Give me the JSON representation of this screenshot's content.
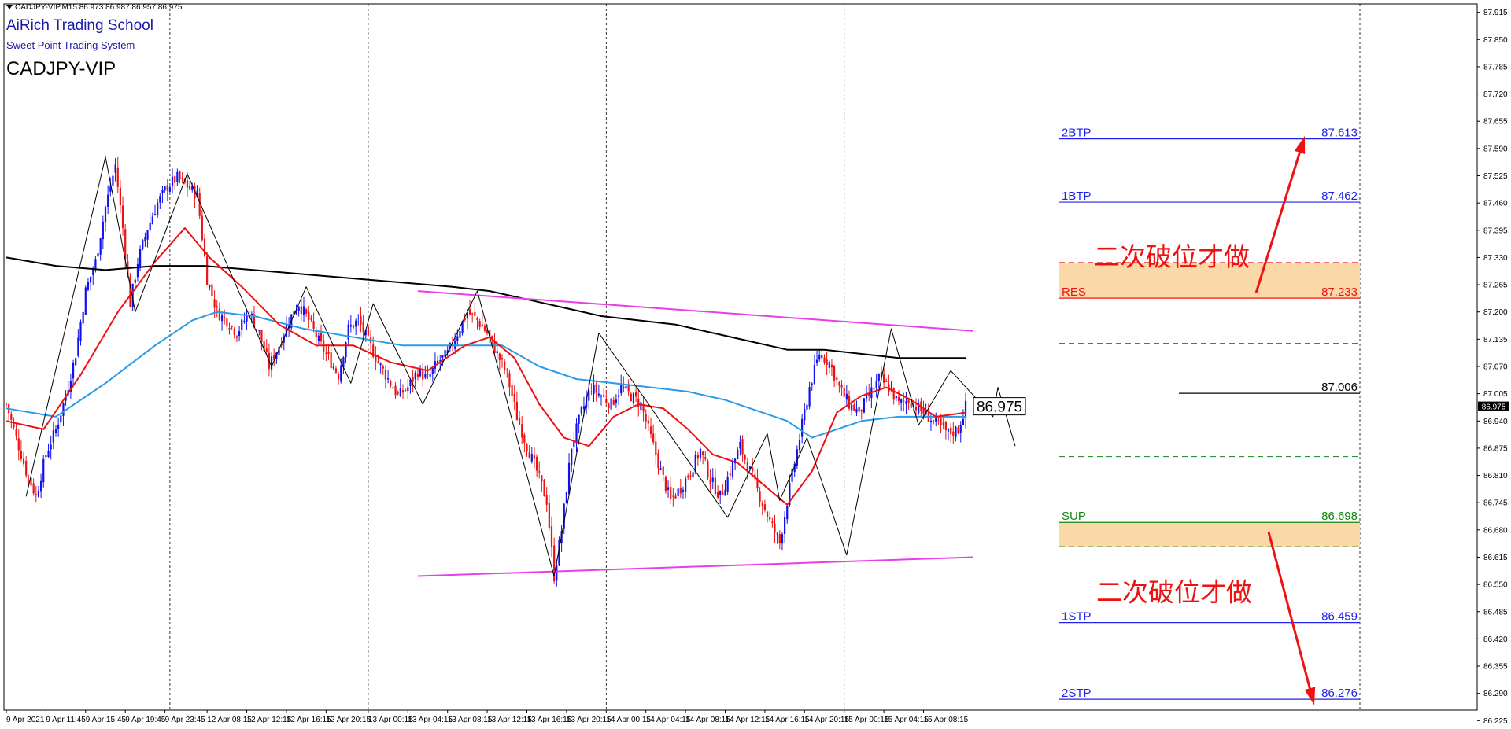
{
  "header": {
    "symbol_bar": "CADJPY-VIP,M15  86.973 86.987 86.957 86.975",
    "school": "AiRich Trading School",
    "system": "Sweet Point Trading System",
    "symbol": "CADJPY-VIP"
  },
  "colors": {
    "bull_candle": "#1111ee",
    "bear_candle": "#ee1111",
    "ma_red": "#ee1111",
    "ma_blue": "#2a9be8",
    "ma_black": "#000000",
    "channel": "#e83ee8",
    "zigzag": "#000000",
    "zone_fill": "#fbd8a8",
    "target_line": "#2222ee",
    "res_line": "#ee1111",
    "sup_line": "#118811",
    "arrow": "#ee1111"
  },
  "chart_data": {
    "type": "candlestick",
    "ylim": [
      86.25,
      87.935
    ],
    "y_ticks": [
      "87.915",
      "87.850",
      "87.785",
      "87.720",
      "87.655",
      "87.590",
      "87.525",
      "87.460",
      "87.395",
      "87.330",
      "87.265",
      "87.200",
      "87.135",
      "87.070",
      "87.005",
      "86.940",
      "86.875",
      "86.810",
      "86.745",
      "86.680",
      "86.615",
      "86.550",
      "86.485",
      "86.420",
      "86.355",
      "86.290",
      "86.225"
    ],
    "x_ticks": [
      "9 Apr 2021",
      "9 Apr 11:45",
      "9 Apr 15:45",
      "9 Apr 19:45",
      "9 Apr 23:45",
      "12 Apr 08:15",
      "12 Apr 12:15",
      "12 Apr 16:15",
      "12 Apr 20:15",
      "13 Apr 00:15",
      "13 Apr 04:15",
      "13 Apr 08:15",
      "13 Apr 12:15",
      "13 Apr 16:15",
      "13 Apr 20:15",
      "14 Apr 00:15",
      "14 Apr 04:15",
      "14 Apr 08:15",
      "14 Apr 12:15",
      "14 Apr 16:15",
      "14 Apr 20:15",
      "15 Apr 00:15",
      "15 Apr 04:15",
      "15 Apr 08:15"
    ],
    "current_price": "86.975",
    "current_price_tag": "86.975",
    "bar_count": 290,
    "close_path": [
      [
        0,
        86.98
      ],
      [
        4,
        86.9
      ],
      [
        8,
        86.82
      ],
      [
        12,
        86.76
      ],
      [
        16,
        86.86
      ],
      [
        20,
        86.92
      ],
      [
        24,
        87.0
      ],
      [
        28,
        87.1
      ],
      [
        32,
        87.25
      ],
      [
        36,
        87.32
      ],
      [
        40,
        87.45
      ],
      [
        44,
        87.55
      ],
      [
        47,
        87.4
      ],
      [
        50,
        87.22
      ],
      [
        53,
        87.32
      ],
      [
        57,
        87.4
      ],
      [
        61,
        87.46
      ],
      [
        65,
        87.5
      ],
      [
        69,
        87.52
      ],
      [
        73,
        87.5
      ],
      [
        77,
        87.48
      ],
      [
        81,
        87.28
      ],
      [
        85,
        87.2
      ],
      [
        89,
        87.18
      ],
      [
        93,
        87.15
      ],
      [
        98,
        87.2
      ],
      [
        102,
        87.15
      ],
      [
        106,
        87.07
      ],
      [
        110,
        87.12
      ],
      [
        114,
        87.18
      ],
      [
        118,
        87.22
      ],
      [
        122,
        87.18
      ],
      [
        126,
        87.13
      ],
      [
        130,
        87.09
      ],
      [
        134,
        87.05
      ],
      [
        138,
        87.16
      ],
      [
        142,
        87.18
      ],
      [
        146,
        87.13
      ],
      [
        150,
        87.08
      ],
      [
        154,
        87.04
      ],
      [
        158,
        87.0
      ],
      [
        162,
        87.02
      ],
      [
        166,
        87.06
      ],
      [
        170,
        87.04
      ],
      [
        174,
        87.08
      ],
      [
        178,
        87.1
      ],
      [
        182,
        87.15
      ],
      [
        186,
        87.2
      ],
      [
        190,
        87.18
      ],
      [
        194,
        87.15
      ],
      [
        198,
        87.1
      ],
      [
        202,
        87.05
      ],
      [
        206,
        86.95
      ],
      [
        210,
        86.88
      ],
      [
        214,
        86.82
      ],
      [
        218,
        86.75
      ],
      [
        221,
        86.57
      ],
      [
        224,
        86.68
      ],
      [
        228,
        86.88
      ],
      [
        232,
        86.96
      ],
      [
        236,
        87.02
      ],
      [
        240,
        87.0
      ],
      [
        244,
        86.98
      ],
      [
        248,
        87.02
      ],
      [
        252,
        87.0
      ],
      [
        256,
        86.98
      ],
      [
        260,
        86.9
      ],
      [
        264,
        86.82
      ],
      [
        268,
        86.75
      ],
      [
        272,
        86.78
      ],
      [
        276,
        86.82
      ],
      [
        280,
        86.87
      ],
      [
        284,
        86.8
      ],
      [
        288,
        86.76
      ],
      [
        292,
        86.82
      ],
      [
        296,
        86.88
      ],
      [
        300,
        86.82
      ],
      [
        304,
        86.76
      ],
      [
        308,
        86.7
      ],
      [
        312,
        86.65
      ],
      [
        316,
        86.78
      ],
      [
        320,
        86.9
      ],
      [
        324,
        87.02
      ],
      [
        328,
        87.1
      ],
      [
        332,
        87.08
      ],
      [
        336,
        87.02
      ],
      [
        340,
        86.98
      ],
      [
        344,
        86.96
      ],
      [
        348,
        87.0
      ],
      [
        352,
        87.04
      ],
      [
        356,
        87.02
      ],
      [
        360,
        86.98
      ],
      [
        364,
        86.99
      ],
      [
        368,
        86.97
      ],
      [
        372,
        86.95
      ],
      [
        376,
        86.93
      ],
      [
        380,
        86.91
      ],
      [
        384,
        86.92
      ],
      [
        387,
        86.975
      ]
    ],
    "ma_red": [
      [
        0,
        86.94
      ],
      [
        15,
        86.92
      ],
      [
        30,
        87.05
      ],
      [
        45,
        87.2
      ],
      [
        60,
        87.32
      ],
      [
        72,
        87.4
      ],
      [
        82,
        87.33
      ],
      [
        95,
        87.26
      ],
      [
        110,
        87.17
      ],
      [
        125,
        87.12
      ],
      [
        140,
        87.12
      ],
      [
        155,
        87.08
      ],
      [
        170,
        87.06
      ],
      [
        185,
        87.12
      ],
      [
        195,
        87.14
      ],
      [
        205,
        87.09
      ],
      [
        215,
        86.98
      ],
      [
        225,
        86.9
      ],
      [
        235,
        86.88
      ],
      [
        245,
        86.95
      ],
      [
        255,
        86.98
      ],
      [
        265,
        86.97
      ],
      [
        275,
        86.92
      ],
      [
        285,
        86.86
      ],
      [
        295,
        86.84
      ],
      [
        305,
        86.79
      ],
      [
        315,
        86.74
      ],
      [
        325,
        86.82
      ],
      [
        335,
        86.96
      ],
      [
        345,
        87.0
      ],
      [
        355,
        87.02
      ],
      [
        365,
        86.99
      ],
      [
        375,
        86.95
      ],
      [
        387,
        86.96
      ]
    ],
    "ma_blue": [
      [
        0,
        86.97
      ],
      [
        20,
        86.95
      ],
      [
        40,
        87.03
      ],
      [
        60,
        87.12
      ],
      [
        75,
        87.18
      ],
      [
        85,
        87.2
      ],
      [
        100,
        87.19
      ],
      [
        120,
        87.16
      ],
      [
        140,
        87.14
      ],
      [
        160,
        87.12
      ],
      [
        180,
        87.12
      ],
      [
        200,
        87.12
      ],
      [
        215,
        87.07
      ],
      [
        230,
        87.04
      ],
      [
        245,
        87.03
      ],
      [
        260,
        87.02
      ],
      [
        275,
        87.01
      ],
      [
        290,
        86.99
      ],
      [
        305,
        86.96
      ],
      [
        315,
        86.94
      ],
      [
        325,
        86.9
      ],
      [
        335,
        86.92
      ],
      [
        345,
        86.94
      ],
      [
        360,
        86.95
      ],
      [
        375,
        86.95
      ],
      [
        387,
        86.95
      ]
    ],
    "ma_black": [
      [
        0,
        87.33
      ],
      [
        20,
        87.31
      ],
      [
        40,
        87.3
      ],
      [
        60,
        87.31
      ],
      [
        80,
        87.31
      ],
      [
        100,
        87.3
      ],
      [
        120,
        87.29
      ],
      [
        140,
        87.28
      ],
      [
        160,
        87.27
      ],
      [
        180,
        87.26
      ],
      [
        195,
        87.25
      ],
      [
        210,
        87.23
      ],
      [
        225,
        87.21
      ],
      [
        240,
        87.19
      ],
      [
        255,
        87.18
      ],
      [
        270,
        87.17
      ],
      [
        285,
        87.15
      ],
      [
        300,
        87.13
      ],
      [
        315,
        87.11
      ],
      [
        330,
        87.11
      ],
      [
        345,
        87.1
      ],
      [
        360,
        87.09
      ],
      [
        370,
        87.09
      ],
      [
        387,
        87.09
      ]
    ],
    "zigzag": [
      [
        8,
        86.76
      ],
      [
        40,
        87.57
      ],
      [
        52,
        87.2
      ],
      [
        73,
        87.53
      ],
      [
        107,
        87.07
      ],
      [
        121,
        87.26
      ],
      [
        139,
        87.03
      ],
      [
        148,
        87.22
      ],
      [
        168,
        86.98
      ],
      [
        190,
        87.25
      ],
      [
        221,
        86.57
      ],
      [
        239,
        87.15
      ],
      [
        291,
        86.71
      ],
      [
        307,
        86.91
      ],
      [
        312,
        86.75
      ],
      [
        323,
        86.9
      ],
      [
        339,
        86.62
      ],
      [
        357,
        87.16
      ],
      [
        368,
        86.93
      ],
      [
        381,
        87.06
      ],
      [
        398,
        86.95
      ],
      [
        400,
        87.02
      ],
      [
        407,
        86.88
      ]
    ],
    "channel_upper": [
      [
        166,
        87.25
      ],
      [
        390,
        87.155
      ]
    ],
    "channel_lower": [
      [
        166,
        86.57
      ],
      [
        390,
        86.615
      ]
    ],
    "levels": [
      {
        "label": "2BTP",
        "value": "87.613",
        "y": 87.613,
        "kind": "target"
      },
      {
        "label": "1BTP",
        "value": "87.462",
        "y": 87.462,
        "kind": "target"
      },
      {
        "label": "RES",
        "value": "87.233",
        "y": 87.233,
        "kind": "res"
      },
      {
        "label": "",
        "value": "87.006",
        "y": 87.006,
        "kind": "pivot"
      },
      {
        "label": "SUP",
        "value": "86.698",
        "y": 86.698,
        "kind": "sup"
      },
      {
        "label": "1STP",
        "value": "86.459",
        "y": 86.459,
        "kind": "target"
      },
      {
        "label": "2STP",
        "value": "86.276",
        "y": 86.276,
        "kind": "target"
      }
    ],
    "res_zone": [
      87.233,
      87.318
    ],
    "sup_zone": [
      86.64,
      86.698
    ],
    "dashed_res": [
      87.318,
      87.125
    ],
    "dashed_sup": [
      86.855,
      86.64
    ],
    "annotations": [
      {
        "text": "二次破位才做",
        "anchor": "upper"
      },
      {
        "text": "二次破位才做",
        "anchor": "lower"
      }
    ]
  }
}
